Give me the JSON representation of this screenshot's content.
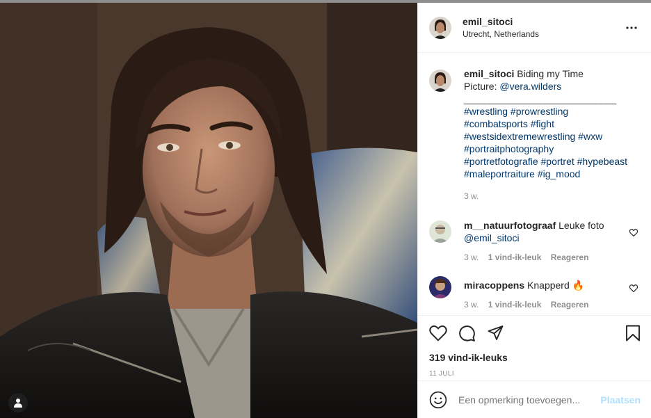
{
  "post": {
    "username": "emil_sitoci",
    "location": "Utrecht, Netherlands"
  },
  "caption": {
    "username": "emil_sitoci",
    "text": "Biding my Time",
    "picture_label": "Picture:",
    "picture_mention": "@vera.wilders",
    "separator": "______________________________",
    "hashtag_lines": [
      "#wrestling #prowrestling",
      "#combatsports #fight",
      "#westsidextremewrestling #wxw",
      "#portraitphotography",
      "#portretfotografie #portret #hypebeast",
      "#maleportraiture #ig_mood"
    ],
    "time": "3 w."
  },
  "comments": [
    {
      "username": "m__natuurfotograaf",
      "text": "Leuke foto",
      "mention": "@emil_sitoci",
      "time": "3 w.",
      "likes": "1 vind-ik-leuk",
      "reply": "Reageren"
    },
    {
      "username": "miracoppens",
      "text": "Knapperd 🔥",
      "time": "3 w.",
      "likes": "1 vind-ik-leuk",
      "reply": "Reageren"
    }
  ],
  "actions": {
    "likes_count": "319 vind-ik-leuks",
    "date": "11 JULI"
  },
  "add_comment": {
    "placeholder": "Een opmerking toevoegen...",
    "post_label": "Plaatsen"
  },
  "icons": [
    "more-icon",
    "heart-icon",
    "comment-icon",
    "share-icon",
    "bookmark-icon",
    "emoji-icon",
    "user-tag-icon"
  ]
}
